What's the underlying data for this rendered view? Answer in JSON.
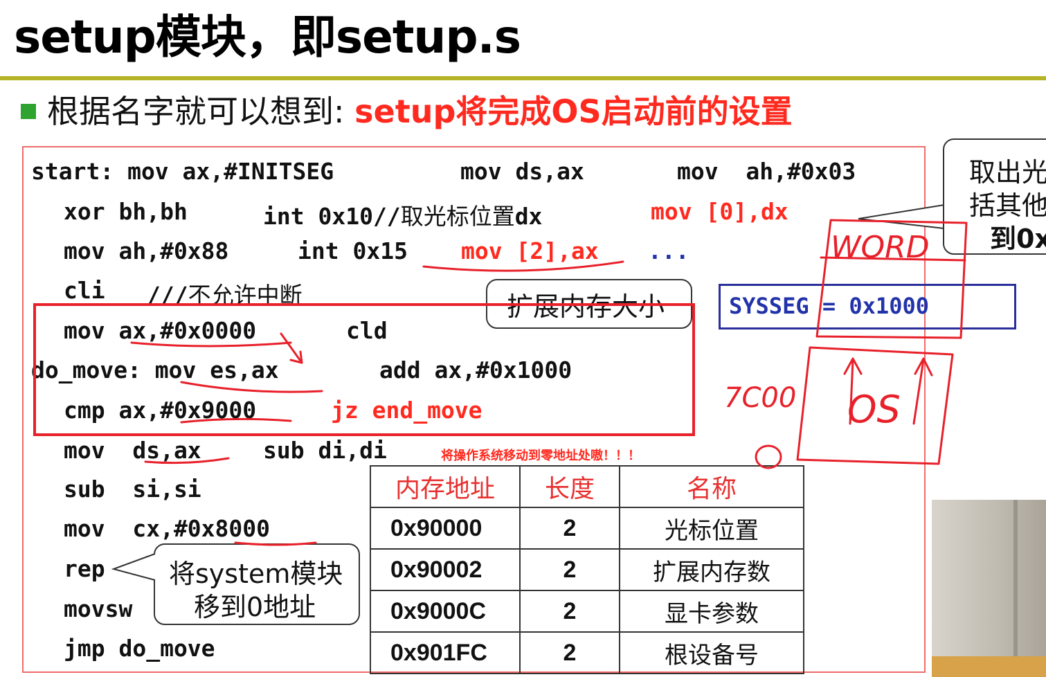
{
  "title": "setup模块，即setup.s",
  "bullet": {
    "prefix": "根据名字就可以想到: ",
    "highlight": "setup将完成OS启动前的设置"
  },
  "code": {
    "line1": {
      "a": "start: mov ax,#INITSEG",
      "b": "mov ds,ax",
      "c": "mov  ah,#0x03"
    },
    "line2": {
      "a": "xor bh,bh",
      "b": "int 0x10//",
      "b_cn": "取光标位置",
      "b2": "dx",
      "c": "mov [0],dx"
    },
    "line3": {
      "a": "mov ah,#0x88",
      "b": "int 0x15",
      "c": "mov [2],ax",
      "d": "..."
    },
    "line4": {
      "a": "cli",
      "b": "///",
      "b_cn": "不允许中断"
    },
    "line5": {
      "a": "mov ax,#0x0000",
      "b": "cld"
    },
    "line6": {
      "a": "do_move: mov es,ax",
      "b": "add ax,#0x1000"
    },
    "line7": {
      "a": "cmp ax,#0x9000",
      "b": "jz end_move"
    },
    "line8": {
      "a": "mov  ds,ax",
      "b": "sub di,di"
    },
    "line9": {
      "a": "sub  si,si"
    },
    "line10": {
      "a": "mov  cx,#0x8000"
    },
    "line11": {
      "a": "rep"
    },
    "line12": {
      "a": "movsw"
    },
    "line13": {
      "a": "jmp do_move"
    }
  },
  "callouts": {
    "ext_mem": "扩展内存大小",
    "system_line1": "将system模块",
    "system_line2": "移到0地址",
    "right_line1": "取出光",
    "right_line2": "括其他",
    "right_line3": "到0x"
  },
  "sysseg": "SYSSEG = 0x1000",
  "move_note": "将操作系统移动到零地址处嗷！！！",
  "table": {
    "headers": [
      "内存地址",
      "长度",
      "名称"
    ],
    "rows": [
      [
        "0x90000",
        "2",
        "光标位置"
      ],
      [
        "0x90002",
        "2",
        "扩展内存数"
      ],
      [
        "0x9000C",
        "2",
        "显卡参数"
      ],
      [
        "0x901FC",
        "2",
        "根设备号"
      ]
    ]
  },
  "handwriting": {
    "top": "WORD",
    "mid": "OS",
    "left": "7C00",
    "zero": "0"
  },
  "colors": {
    "accent_red": "#ff2a1f",
    "rule": "#b5b427",
    "bullet": "#2fa32f",
    "sysseg": "#2a2f9a",
    "box_red": "#e8202a"
  }
}
